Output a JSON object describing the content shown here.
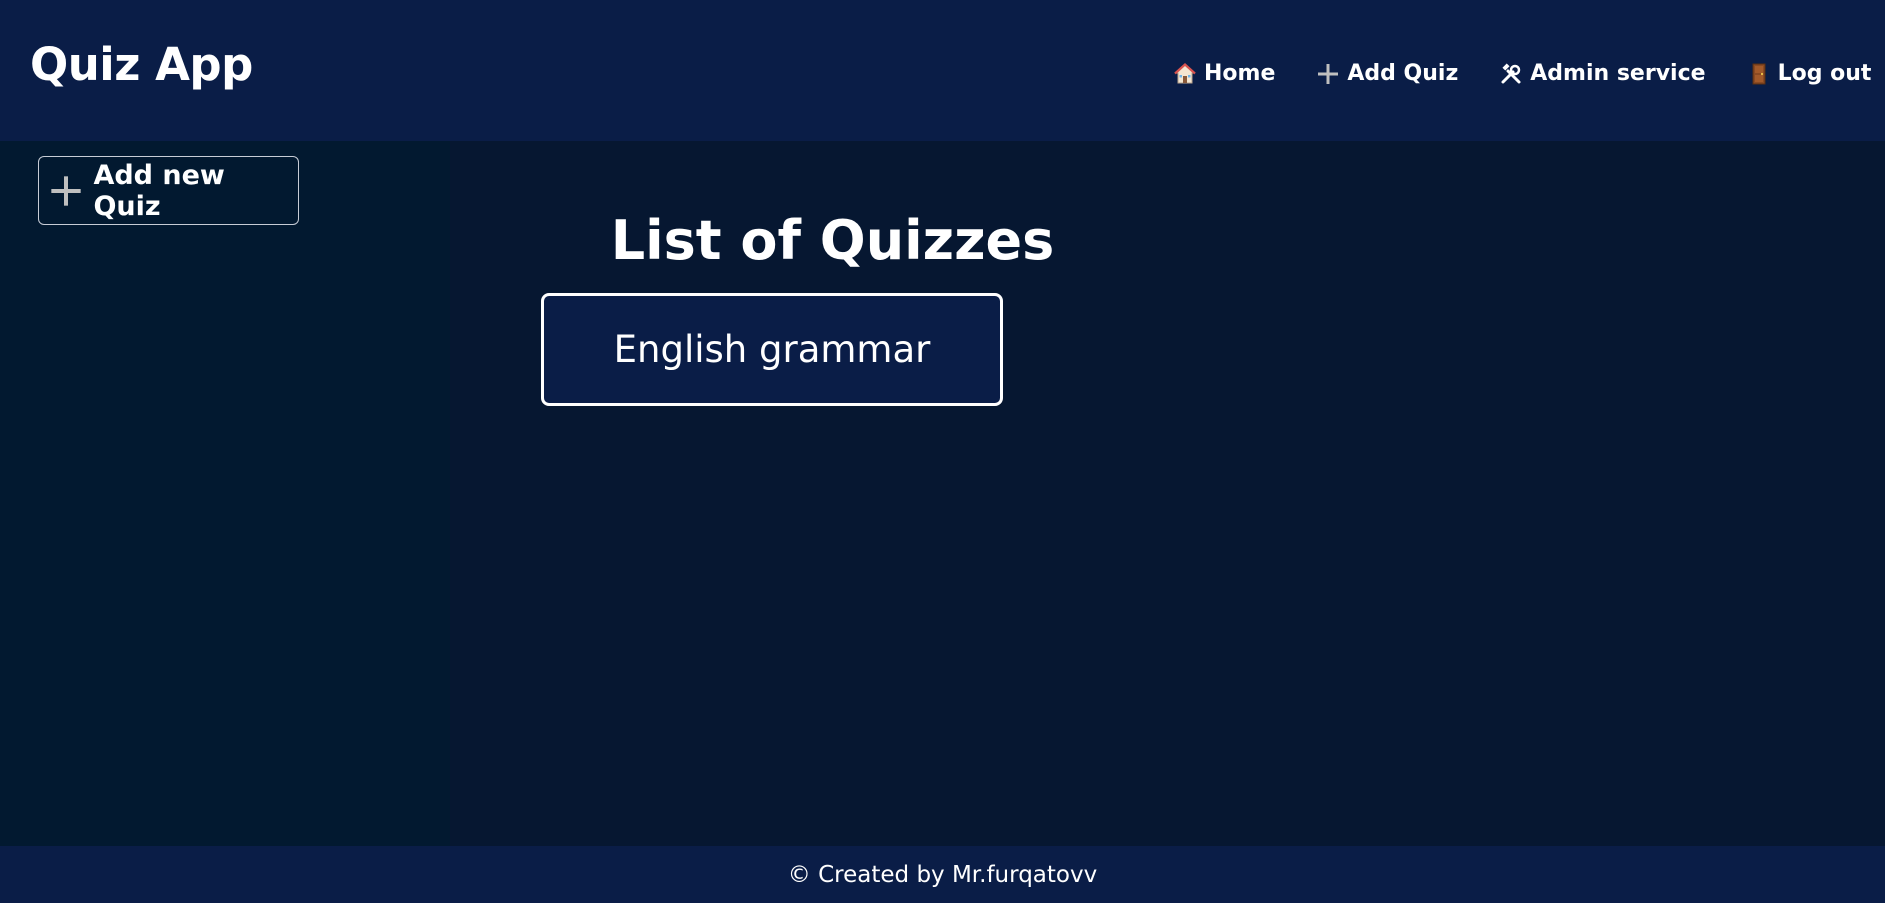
{
  "header": {
    "app_title": "Quiz App",
    "nav": [
      {
        "label": "Home",
        "icon": "house-icon"
      },
      {
        "label": "Add Quiz",
        "icon": "plus-icon"
      },
      {
        "label": "Admin service",
        "icon": "tools-icon"
      },
      {
        "label": "Log out",
        "icon": "door-icon"
      }
    ]
  },
  "sidebar": {
    "add_button_label": "Add new Quiz",
    "add_button_icon": "plus-icon"
  },
  "main": {
    "title": "List of Quizzes",
    "quizzes": [
      {
        "name": "English grammar"
      }
    ]
  },
  "footer": {
    "text": "© Created by Mr.furqatovv"
  },
  "colors": {
    "header_bg": "#0a1d47",
    "sidebar_bg": "#021930",
    "main_bg": "#061731",
    "text": "#ffffff"
  }
}
